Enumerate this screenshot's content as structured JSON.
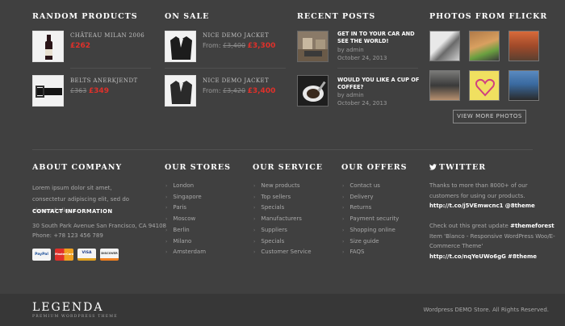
{
  "random_products": {
    "heading": "Random Products",
    "items": [
      {
        "name": "Château Milan 2006",
        "price": "£262",
        "old_price": "",
        "from": ""
      },
      {
        "name": "Belts Anerkjendt",
        "price": "£349",
        "old_price": "£363",
        "from": ""
      }
    ]
  },
  "on_sale": {
    "heading": "On Sale",
    "items": [
      {
        "name": "Nice Demo Jacket",
        "from": "From:",
        "old_price": "£3,400",
        "price": "£3,300"
      },
      {
        "name": "Nice Demo Jacket",
        "from": "From:",
        "old_price": "£3,420",
        "price": "£3,400"
      }
    ]
  },
  "recent_posts": {
    "heading": "Recent Posts",
    "items": [
      {
        "title": "Get in to your car and see the world!",
        "by": "by admin",
        "date": "October 24, 2013"
      },
      {
        "title": "Would you like a cup of coffee?",
        "by": "by admin",
        "date": "October 24, 2013"
      }
    ]
  },
  "flickr": {
    "heading": "Photos from Flickr",
    "button": "View more photos"
  },
  "about": {
    "heading": "About Company",
    "text": "Lorem ipsum dolor sit amet, consectetur adipiscing elit, sed do eiusmod aliqua.",
    "contact_heading": "Contact Information",
    "address": "30 South Park Avenue San Francisco, CA 94108",
    "phone": "Phone: +78 123 456 789",
    "cards": [
      "PayPal",
      "MasterCard",
      "VISA",
      "DISCOVER"
    ]
  },
  "stores": {
    "heading": "Our Stores",
    "items": [
      "London",
      "Singapore",
      "Paris",
      "Moscow",
      "Berlin",
      "Milano",
      "Amsterdam"
    ]
  },
  "service": {
    "heading": "Our Service",
    "items": [
      "New products",
      "Top sellers",
      "Specials",
      "Manufacturers",
      "Suppliers",
      "Specials",
      "Customer Service"
    ]
  },
  "offers": {
    "heading": "Our Offers",
    "items": [
      "Contact us",
      "Delivery",
      "Returns",
      "Payment security",
      "Shopping online",
      "Size guide",
      "FAQS"
    ]
  },
  "twitter": {
    "heading": "Twitter",
    "t1_text": "Thanks to more than 8000+ of our customers for using our products.",
    "t1_link": "http://t.co/j5VEmwcnc1",
    "t1_handle": "@8theme",
    "t2_pre": "Check out this great update",
    "t2_tag": "#themeforest",
    "t2_mid": "Item 'Blanco - Responsive WordPress Woo/E-Commerce Theme'",
    "t2_link": "http://t.co/nqYeUWo6gG",
    "t2_handle": "#8theme"
  },
  "footer": {
    "logo": "LEGENDA",
    "tagline": "PREMIUM WORDPRESS THEME",
    "copyright": "Wordpress DEMO Store. All Rights Reserved."
  },
  "colors": {
    "background": "#404040",
    "bottom_bar": "#373737",
    "accent_red": "#e0302a"
  }
}
